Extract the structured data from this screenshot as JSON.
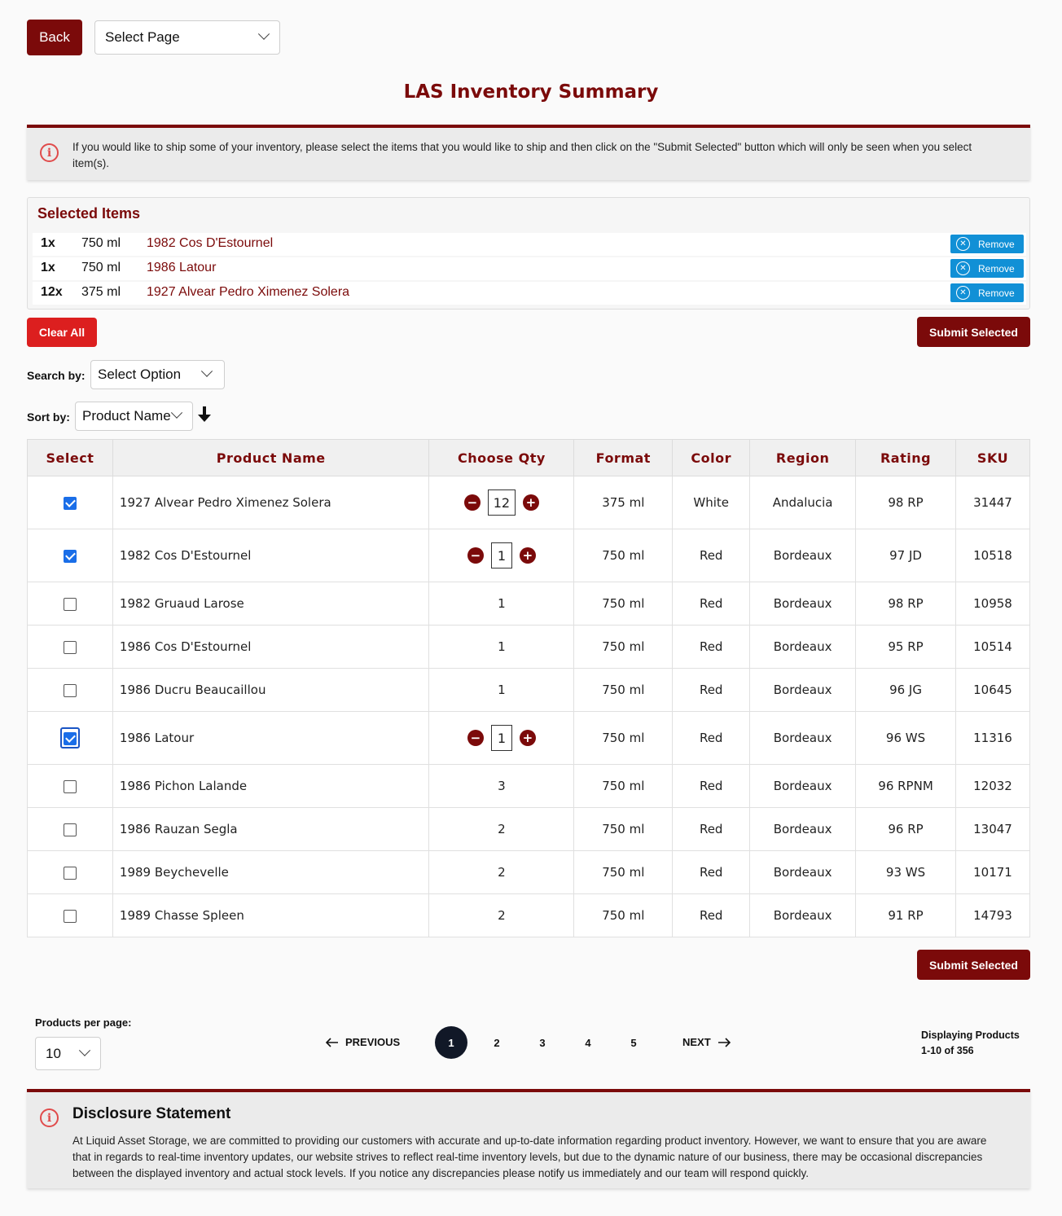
{
  "nav": {
    "back_label": "Back",
    "page_select": "Select Page"
  },
  "title": "LAS Inventory Summary",
  "info_alert": "If you would like to ship some of your inventory, please select the items that you would like to ship and then click on the \"Submit Selected\" button which will only be seen when you select item(s).",
  "selected": {
    "title": "Selected Items",
    "remove_label": "Remove",
    "items": [
      {
        "qty": "1x",
        "format": "750 ml",
        "name": "1982 Cos D'Estournel"
      },
      {
        "qty": "1x",
        "format": "750 ml",
        "name": "1986 Latour"
      },
      {
        "qty": "12x",
        "format": "375 ml",
        "name": "1927 Alvear Pedro Ximenez Solera"
      }
    ]
  },
  "actions": {
    "clear_all": "Clear All",
    "submit_selected": "Submit Selected"
  },
  "search": {
    "label": "Search by:",
    "value": "Select Option"
  },
  "sort": {
    "label": "Sort by:",
    "value": "Product Name",
    "direction_icon": "arrow-down-icon"
  },
  "table": {
    "headers": [
      "Select",
      "Product Name",
      "Choose Qty",
      "Format",
      "Color",
      "Region",
      "Rating",
      "SKU"
    ],
    "rows": [
      {
        "selected": true,
        "name": "1927 Alvear Pedro Ximenez Solera",
        "qty": "12",
        "format": "375 ml",
        "color": "White",
        "region": "Andalucia",
        "rating": "98 RP",
        "sku": "31447"
      },
      {
        "selected": true,
        "name": "1982 Cos D'Estournel",
        "qty": "1",
        "format": "750 ml",
        "color": "Red",
        "region": "Bordeaux",
        "rating": "97 JD",
        "sku": "10518"
      },
      {
        "selected": false,
        "name": "1982 Gruaud Larose",
        "qty": "1",
        "format": "750 ml",
        "color": "Red",
        "region": "Bordeaux",
        "rating": "98 RP",
        "sku": "10958"
      },
      {
        "selected": false,
        "name": "1986 Cos D'Estournel",
        "qty": "1",
        "format": "750 ml",
        "color": "Red",
        "region": "Bordeaux",
        "rating": "95 RP",
        "sku": "10514"
      },
      {
        "selected": false,
        "name": "1986 Ducru Beaucaillou",
        "qty": "1",
        "format": "750 ml",
        "color": "Red",
        "region": "Bordeaux",
        "rating": "96 JG",
        "sku": "10645"
      },
      {
        "selected": true,
        "name": "1986 Latour",
        "qty": "1",
        "format": "750 ml",
        "color": "Red",
        "region": "Bordeaux",
        "rating": "96 WS",
        "sku": "11316"
      },
      {
        "selected": false,
        "name": "1986 Pichon Lalande",
        "qty": "3",
        "format": "750 ml",
        "color": "Red",
        "region": "Bordeaux",
        "rating": "96 RPNM",
        "sku": "12032"
      },
      {
        "selected": false,
        "name": "1986 Rauzan Segla",
        "qty": "2",
        "format": "750 ml",
        "color": "Red",
        "region": "Bordeaux",
        "rating": "96 RP",
        "sku": "13047"
      },
      {
        "selected": false,
        "name": "1989 Beychevelle",
        "qty": "2",
        "format": "750 ml",
        "color": "Red",
        "region": "Bordeaux",
        "rating": "93 WS",
        "sku": "10171"
      },
      {
        "selected": false,
        "name": "1989 Chasse Spleen",
        "qty": "2",
        "format": "750 ml",
        "color": "Red",
        "region": "Bordeaux",
        "rating": "91 RP",
        "sku": "14793"
      }
    ]
  },
  "pagination": {
    "per_page_label": "Products per page:",
    "per_page_value": "10",
    "prev_label": "PREVIOUS",
    "next_label": "NEXT",
    "pages": [
      "1",
      "2",
      "3",
      "4",
      "5"
    ],
    "current_page": "1",
    "display_line1": "Displaying Products",
    "display_line2": "1-10 of 356"
  },
  "disclosure": {
    "title": "Disclosure Statement",
    "text": "At Liquid Asset Storage, we are committed to providing our customers with accurate and up-to-date information regarding product inventory. However, we want to ensure that you are aware that in regards to real-time inventory updates, our website strives to reflect real-time inventory levels, but due to the dynamic nature of our business, there may be occasional discrepancies between the displayed inventory and actual stock levels. If you notice any discrepancies please notify us immediately and our team will respond quickly."
  },
  "colors": {
    "brand": "#7b0a0a",
    "danger": "#dc1f1f",
    "info": "#1190d6",
    "checkbox": "#1a6ee8"
  }
}
